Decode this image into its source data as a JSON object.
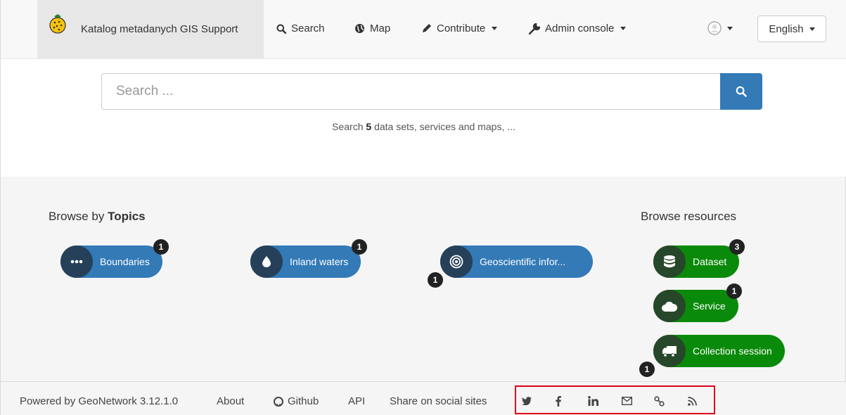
{
  "navbar": {
    "brand_title": "Katalog metadanych GIS Support",
    "items": [
      {
        "label": "Search",
        "icon": "search-icon"
      },
      {
        "label": "Map",
        "icon": "globe-icon"
      },
      {
        "label": "Contribute",
        "icon": "pencil-icon"
      },
      {
        "label": "Admin console",
        "icon": "wrench-icon"
      }
    ],
    "language": "English"
  },
  "search": {
    "placeholder": "Search ...",
    "hint_prefix": "Search",
    "hint_count": "5",
    "hint_suffix": "data sets, services and maps, ..."
  },
  "topics": {
    "title_prefix": "Browse by",
    "title_bold": "Topics",
    "items": [
      {
        "label": "Boundaries",
        "count": "1",
        "icon": "dots-icon"
      },
      {
        "label": "Inland waters",
        "count": "1",
        "icon": "drop-icon"
      },
      {
        "label": "Geoscientific infor...",
        "count": "1",
        "icon": "target-icon"
      }
    ]
  },
  "resources": {
    "title": "Browse resources",
    "items": [
      {
        "label": "Dataset",
        "count": "3",
        "icon": "database-icon"
      },
      {
        "label": "Service",
        "count": "1",
        "icon": "cloud-icon"
      },
      {
        "label": "Collection session",
        "count": "1",
        "icon": "truck-icon"
      }
    ]
  },
  "footer": {
    "powered_by": "Powered by GeoNetwork 3.12.1.0",
    "about": "About",
    "github": "Github",
    "api": "API",
    "share": "Share on social sites",
    "social_icons": [
      "twitter-icon",
      "facebook-icon",
      "linkedin-icon",
      "email-icon",
      "link-icon",
      "rss-icon"
    ]
  },
  "colors": {
    "primary": "#337ab7",
    "primary_dark": "#26405a",
    "green": "#0a8a0a",
    "green_dark": "#27472a",
    "badge": "#222222",
    "highlight_border": "#e0001a"
  }
}
